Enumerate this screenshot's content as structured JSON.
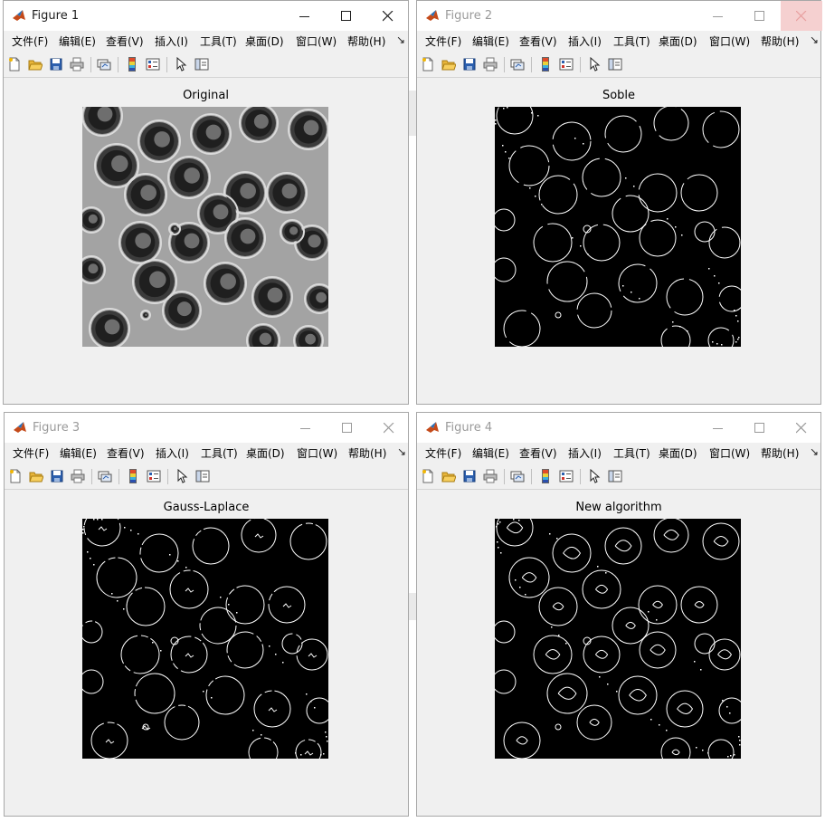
{
  "menu_labels": [
    "文件(F)",
    "编辑(E)",
    "查看(V)",
    "插入(I)",
    "工具(T)",
    "桌面(D)",
    "窗口(W)",
    "帮助(H)"
  ],
  "menu_more_glyph": "↘",
  "toolbar_icons": [
    "new-figure-icon",
    "open-file-icon",
    "save-icon",
    "print-icon",
    "link-plot-icon",
    "insert-colorbar-icon",
    "insert-legend-icon",
    "edit-plot-pointer-icon",
    "property-inspector-icon"
  ],
  "colors": {
    "window_bg": "#f0f0f0",
    "titlebar_bg": "#ffffff",
    "title_active": "#1e1e1e",
    "title_inactive": "#9a9a9a",
    "axes_bg": "#000000",
    "edge": "#ffffff",
    "close_hover": "#f5d0d0"
  },
  "figures": [
    {
      "title": "Figure 1",
      "axes_title": "Original",
      "active": true,
      "image": "blood-cells-grayscale"
    },
    {
      "title": "Figure 2",
      "axes_title": "Soble",
      "active": false,
      "image": "edge-map-soble"
    },
    {
      "title": "Figure 3",
      "axes_title": "Gauss-Laplace",
      "active": false,
      "image": "edge-map-gauss-laplace"
    },
    {
      "title": "Figure 4",
      "axes_title": "New algorithm",
      "active": false,
      "image": "edge-map-new-algorithm"
    }
  ]
}
